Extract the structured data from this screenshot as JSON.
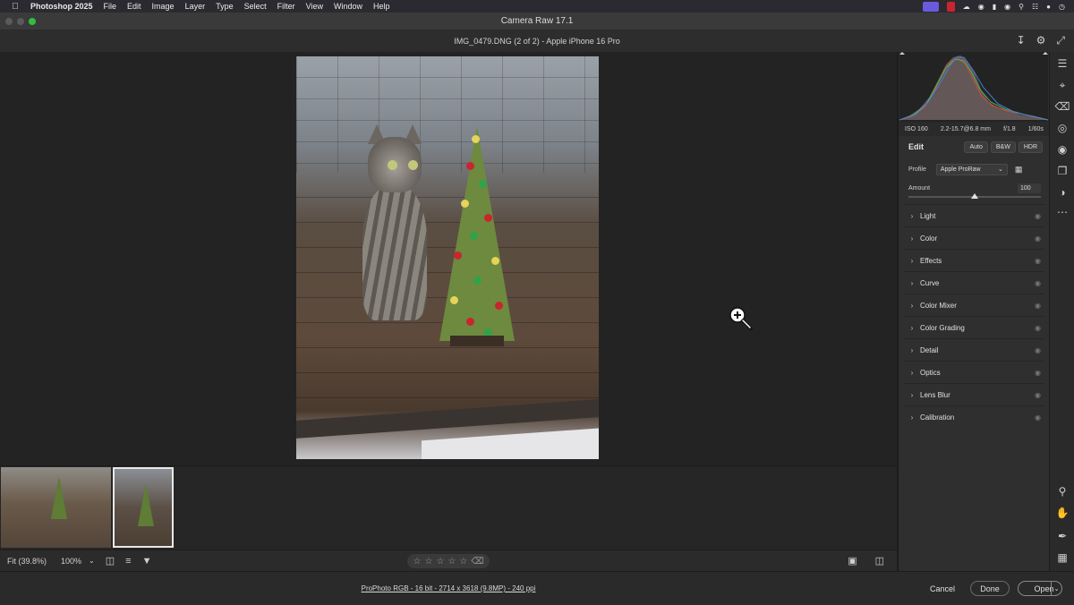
{
  "menubar": {
    "app": "Photoshop 2025",
    "items": [
      "File",
      "Edit",
      "Image",
      "Layer",
      "Type",
      "Select",
      "Filter",
      "View",
      "Window",
      "Help"
    ]
  },
  "window": {
    "title": "Camera Raw 17.1"
  },
  "header": {
    "file_info": "IMG_0479.DNG (2 of 2)  -  Apple iPhone 16 Pro"
  },
  "histogram": {
    "exif": {
      "iso": "ISO 160",
      "lens": "2.2-15.7@6.8 mm",
      "aperture": "f/1.8",
      "shutter": "1/60s"
    }
  },
  "edit": {
    "title": "Edit",
    "buttons": [
      "Auto",
      "B&W",
      "HDR"
    ],
    "profile_label": "Profile",
    "profile_value": "Apple ProRaw",
    "amount_label": "Amount",
    "amount_value": "100",
    "amount_fraction": 0.5
  },
  "sections": [
    "Light",
    "Color",
    "Effects",
    "Curve",
    "Color Mixer",
    "Color Grading",
    "Detail",
    "Optics",
    "Lens Blur",
    "Calibration"
  ],
  "toolbar": {
    "fit": "Fit (39.8%)",
    "zoom": "100%"
  },
  "footer": {
    "info": "ProPhoto RGB - 16 bit - 2714 x 3618 (9.8MP) - 240 ppi",
    "cancel": "Cancel",
    "done": "Done",
    "open": "Open"
  },
  "colors": {
    "accent_green": "#2fbf3f",
    "panel_bg": "#2f2f2f",
    "canvas_bg": "#232323"
  }
}
